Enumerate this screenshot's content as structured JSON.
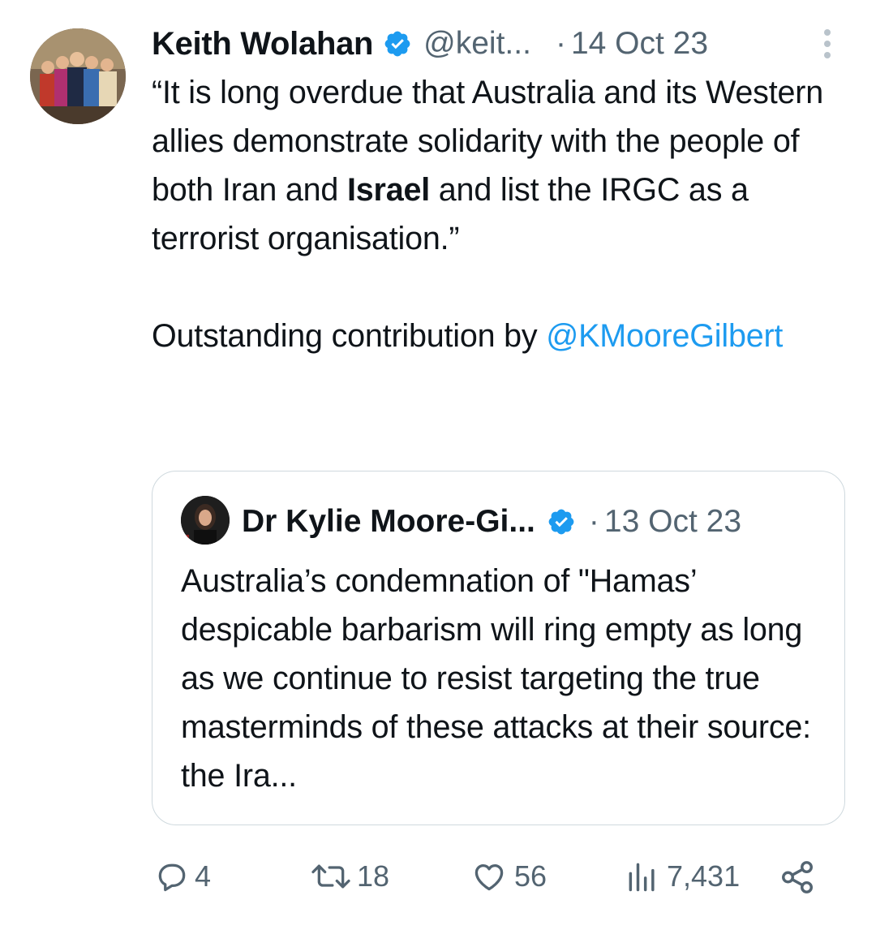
{
  "tweet": {
    "author_name": "Keith Wolahan",
    "handle": "@keit...",
    "date_separator": "·",
    "date": "14 Oct 23",
    "text_part1": "“It is long overdue that Australia and its Western allies demonstrate solidarity with the people of both Iran and ",
    "text_bold": "Israel",
    "text_part2": " and list the IRGC as a terrorist organisation.”",
    "text_line2": "Outstanding contribution by ",
    "mention": "@KMooreGilbert"
  },
  "quoted_tweet": {
    "author_name": "Dr Kylie Moore-Gi...",
    "date_separator": "·",
    "date": "13 Oct 23",
    "text": "Australia’s condemnation of \"Hamas’ despicable barbarism will ring empty as long as we continue to resist targeting the true masterminds of these attacks at their source: the Ira..."
  },
  "actions": {
    "replies": "4",
    "reposts": "18",
    "likes": "56",
    "views": "7,431"
  },
  "colors": {
    "accent": "#1d9bf0",
    "muted": "#536471",
    "border": "#cfd9de"
  },
  "icons": [
    "verified-badge-icon",
    "more-options-icon",
    "reply-icon",
    "repost-icon",
    "like-icon",
    "views-icon",
    "share-icon"
  ]
}
